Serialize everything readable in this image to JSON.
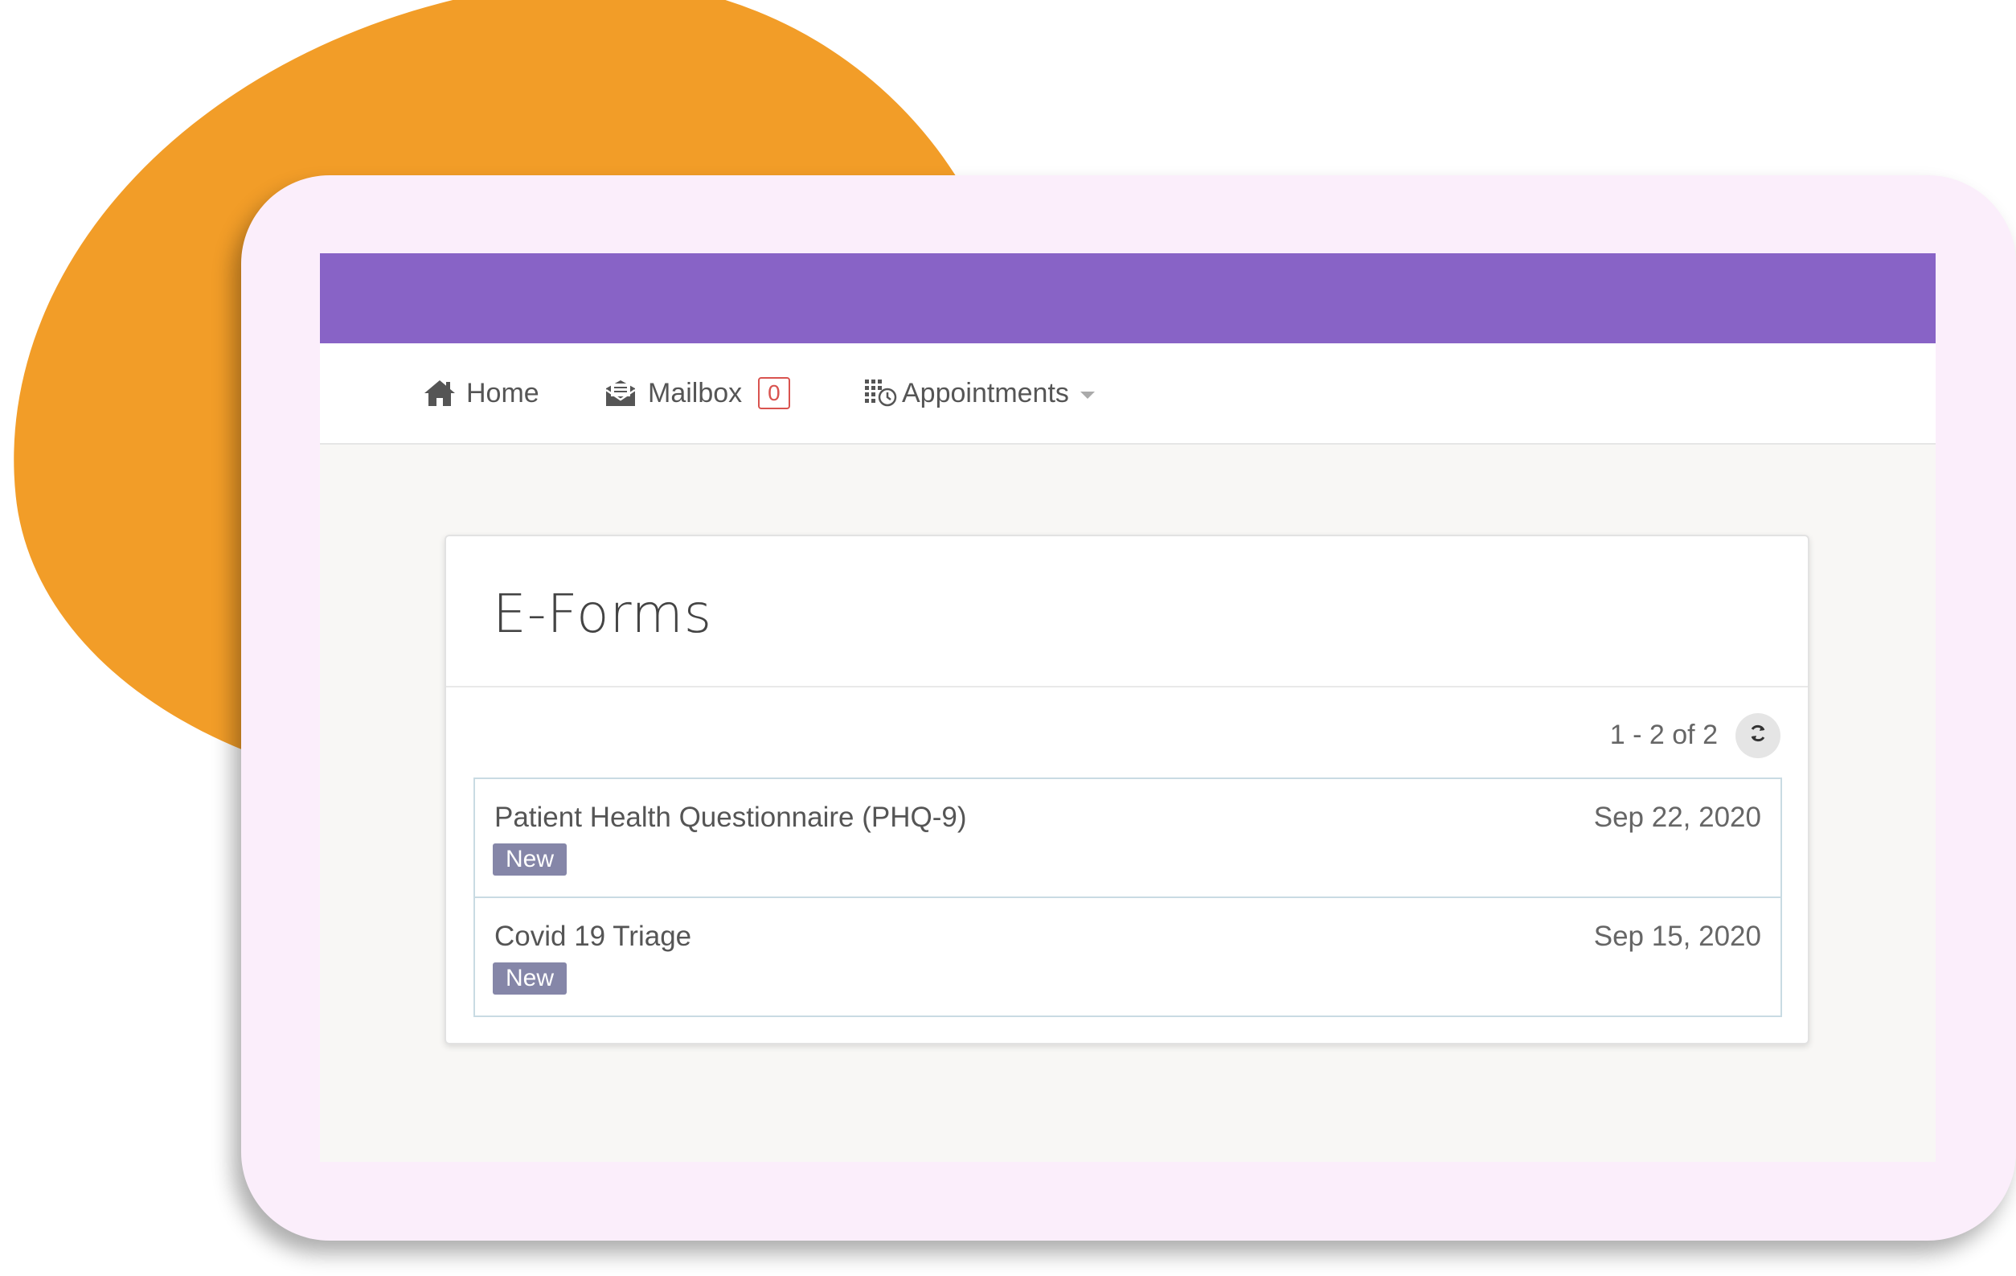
{
  "colors": {
    "accent_purple": "#8863c6",
    "blob_orange": "#f29d28",
    "tablet_frame": "#fbeefb",
    "badge_red": "#d9534f",
    "tag_slate": "#8586a8"
  },
  "nav": {
    "home": {
      "label": "Home",
      "icon": "home-icon"
    },
    "mailbox": {
      "label": "Mailbox",
      "icon": "envelope-icon",
      "count": "0"
    },
    "appointments": {
      "label": "Appointments",
      "icon": "calendar-clock-icon"
    }
  },
  "eforms": {
    "title": "E-Forms",
    "pager": "1 - 2 of 2",
    "refresh_icon": "refresh-icon",
    "items": [
      {
        "title": "Patient Health Questionnaire (PHQ-9)",
        "date": "Sep 22, 2020",
        "status": "New"
      },
      {
        "title": "Covid 19 Triage",
        "date": "Sep 15, 2020",
        "status": "New"
      }
    ]
  }
}
